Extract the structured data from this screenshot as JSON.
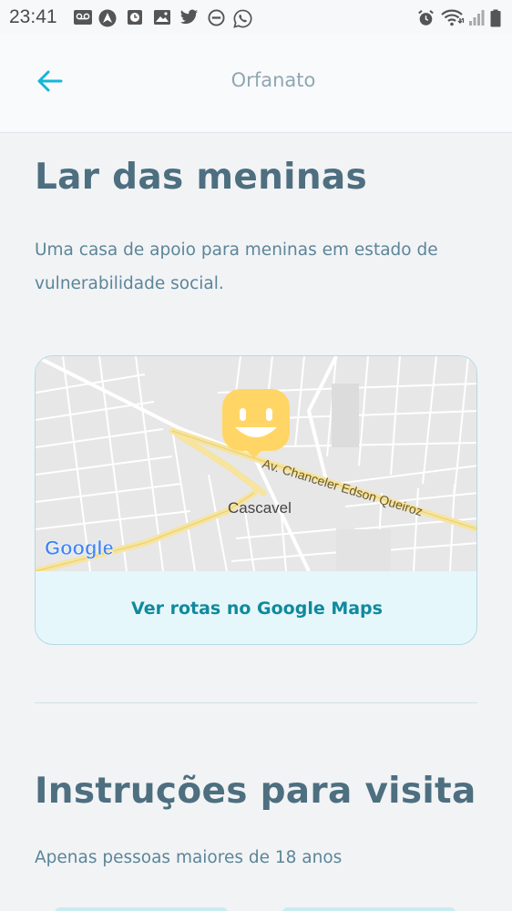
{
  "status_bar": {
    "time": "23:41",
    "icons_left": [
      "voicemail-icon",
      "navigation-icon",
      "clock-icon",
      "gallery-icon",
      "twitter-icon",
      "do-not-disturb-icon",
      "whatsapp-icon"
    ],
    "icons_right": [
      "alarm-icon",
      "wifi-icon",
      "signal-icon",
      "battery-icon"
    ]
  },
  "header": {
    "title": "Orfanato",
    "back_icon": "arrow-left-icon",
    "accent_color": "#15b6d6"
  },
  "orphanage": {
    "name": "Lar das meninas",
    "description": "Uma casa de apoio para meninas em estado de vulnerabilidade social."
  },
  "map": {
    "street_label": "Av. Chanceler Edson Queiroz",
    "city_label": "Cascavel",
    "logo_text": "Google",
    "marker_icon": "smiley-marker-icon",
    "marker_color": "#ffd666",
    "routes_link": "Ver rotas no Google Maps"
  },
  "visit": {
    "title": "Instruções para visita",
    "subtitle": "Apenas pessoas maiores de 18 anos"
  }
}
